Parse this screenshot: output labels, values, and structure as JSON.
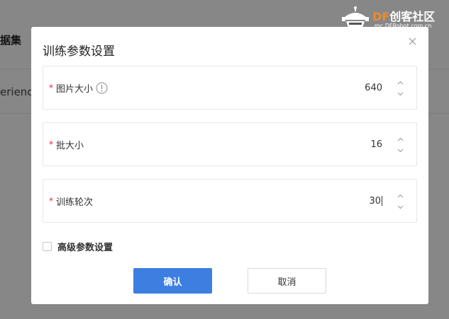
{
  "background": {
    "tab_label": "据集",
    "row_text": "erience"
  },
  "watermark": {
    "brand_df": "DF",
    "brand_rest": "创客社区",
    "url": "mc.DFRobot.com.cn"
  },
  "dialog": {
    "title": "训练参数设置",
    "fields": [
      {
        "required_mark": "*",
        "label": "图片大小",
        "value": "640",
        "has_info": true
      },
      {
        "required_mark": "*",
        "label": "批大小",
        "value": "16",
        "has_info": false
      },
      {
        "required_mark": "*",
        "label": "训练轮次",
        "value": "30",
        "has_info": false
      }
    ],
    "advanced_checkbox_label": "高级参数设置",
    "advanced_checked": false,
    "confirm_label": "确认",
    "cancel_label": "取消"
  },
  "colors": {
    "primary": "#3d7fe0",
    "required": "#f5222d",
    "brand_orange": "#f08a2c"
  },
  "icons": {
    "close": "close-icon",
    "info": "info-circle-icon",
    "up": "chevron-up-icon",
    "down": "chevron-down-icon"
  }
}
